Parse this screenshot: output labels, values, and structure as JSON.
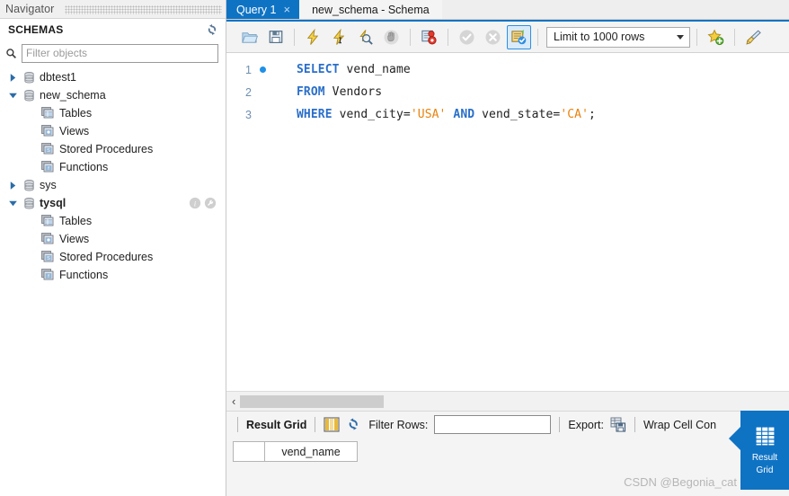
{
  "navigator": {
    "title": "Navigator",
    "schemas_header": "SCHEMAS",
    "refresh_icon": "refresh-icon",
    "search_icon": "search-icon",
    "filter_placeholder": "Filter objects",
    "filter_value": "",
    "tree": [
      {
        "label": "dbtest1",
        "level": 1,
        "expanded": false,
        "icon": "database-icon",
        "bold": false
      },
      {
        "label": "new_schema",
        "level": 1,
        "expanded": true,
        "icon": "database-icon",
        "bold": false
      },
      {
        "label": "Tables",
        "level": 2,
        "icon": "tables-icon"
      },
      {
        "label": "Views",
        "level": 2,
        "icon": "views-icon"
      },
      {
        "label": "Stored Procedures",
        "level": 2,
        "icon": "stored-procedures-icon"
      },
      {
        "label": "Functions",
        "level": 2,
        "icon": "functions-icon"
      },
      {
        "label": "sys",
        "level": 1,
        "expanded": false,
        "icon": "database-icon",
        "bold": false
      },
      {
        "label": "tysql",
        "level": 1,
        "expanded": true,
        "icon": "database-icon",
        "bold": true,
        "actions": [
          "info-icon",
          "wrench-icon"
        ]
      },
      {
        "label": "Tables",
        "level": 2,
        "icon": "tables-icon"
      },
      {
        "label": "Views",
        "level": 2,
        "icon": "views-icon"
      },
      {
        "label": "Stored Procedures",
        "level": 2,
        "icon": "stored-procedures-icon"
      },
      {
        "label": "Functions",
        "level": 2,
        "icon": "functions-icon"
      }
    ]
  },
  "tabs": [
    {
      "label": "Query 1",
      "active": true,
      "closable": true,
      "close_glyph": "×"
    },
    {
      "label": "new_schema - Schema",
      "active": false,
      "closable": false
    }
  ],
  "toolbar": {
    "buttons": [
      {
        "name": "open-sql-file-icon",
        "title": "Open a SQL script file"
      },
      {
        "name": "save-sql-file-icon",
        "title": "Save"
      },
      {
        "name": "execute-statement-icon",
        "title": "Execute"
      },
      {
        "name": "execute-current-statement-icon",
        "title": "Execute current statement"
      },
      {
        "name": "explain-statement-icon",
        "title": "Explain"
      },
      {
        "name": "stop-execution-icon",
        "title": "Stop"
      },
      {
        "name": "toggle-breakpoint-icon",
        "title": "Toggle breakpoint"
      },
      {
        "name": "commit-icon",
        "title": "Commit"
      },
      {
        "name": "rollback-icon",
        "title": "Rollback"
      },
      {
        "name": "autocommit-toggle-icon",
        "title": "Toggle auto-commit",
        "active": true
      }
    ],
    "limit_label": "Limit to 1000 rows",
    "snippet_icon": "add-snippet-icon",
    "beautify_icon": "beautify-sql-icon"
  },
  "editor": {
    "lines": [
      {
        "number": "1",
        "marker": true,
        "tokens": [
          {
            "t": "SELECT",
            "c": "kw"
          },
          {
            "t": " vend_name",
            "c": "pl"
          }
        ]
      },
      {
        "number": "2",
        "marker": false,
        "tokens": [
          {
            "t": "FROM",
            "c": "kw"
          },
          {
            "t": " Vendors",
            "c": "pl"
          }
        ]
      },
      {
        "number": "3",
        "marker": false,
        "tokens": [
          {
            "t": "WHERE",
            "c": "kw"
          },
          {
            "t": " vend_city=",
            "c": "pl"
          },
          {
            "t": "'USA'",
            "c": "str"
          },
          {
            "t": " ",
            "c": "pl"
          },
          {
            "t": "AND",
            "c": "kw"
          },
          {
            "t": " vend_state=",
            "c": "pl"
          },
          {
            "t": "'CA'",
            "c": "str"
          },
          {
            "t": ";",
            "c": "pl"
          }
        ]
      }
    ],
    "scroll_chevron": "‹"
  },
  "result_panel": {
    "result_grid_label": "Result Grid",
    "grid-view-icon": "grid-view-icon",
    "refresh_icon": "refresh-grid-icon",
    "filter_rows_label": "Filter Rows:",
    "filter_rows_value": "",
    "export_label": "Export:",
    "export_icon": "export-recordset-icon",
    "wrap_cell_label": "Wrap Cell Con",
    "columns": [
      "",
      "vend_name"
    ],
    "rows": [],
    "side_tab": {
      "line1": "Result",
      "line2": "Grid",
      "icon": "result-grid-icon"
    }
  },
  "watermark": "CSDN @Begonia_cat",
  "colors": {
    "accent": "#0f73c4",
    "keyword": "#2a6fc9",
    "string": "#e8820c",
    "gutter": "#6f8faf",
    "marker": "#1e90e8"
  }
}
